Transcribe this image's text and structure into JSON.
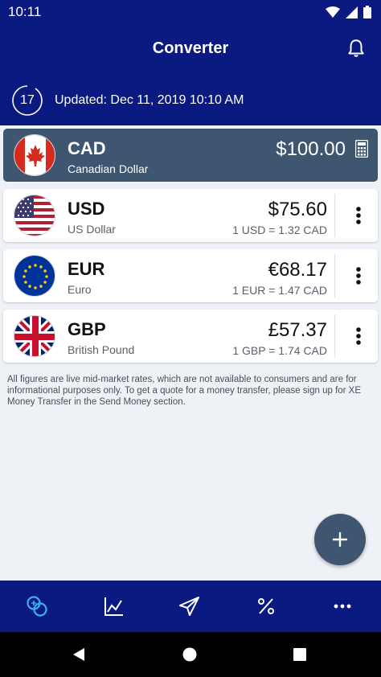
{
  "status_bar": {
    "time": "10:11"
  },
  "app_bar": {
    "title": "Converter",
    "timer_value": "17",
    "updated_text": "Updated: Dec 11, 2019 10:10 AM"
  },
  "base_currency": {
    "code": "CAD",
    "name": "Canadian Dollar",
    "amount": "$100.00",
    "flag_icon": "canada-flag-icon"
  },
  "currencies": [
    {
      "code": "USD",
      "name": "US Dollar",
      "amount": "$75.60",
      "rate": "1 USD = 1.32 CAD",
      "flag_icon": "usa-flag-icon"
    },
    {
      "code": "EUR",
      "name": "Euro",
      "amount": "€68.17",
      "rate": "1 EUR = 1.47 CAD",
      "flag_icon": "eu-flag-icon"
    },
    {
      "code": "GBP",
      "name": "British Pound",
      "amount": "£57.37",
      "rate": "1 GBP = 1.74 CAD",
      "flag_icon": "uk-flag-icon"
    }
  ],
  "disclaimer": "All figures are live mid-market rates, which are not available to consumers and are for informational purposes only. To get a quote for a money transfer, please sign up for XE Money Transfer in the Send Money section.",
  "bottom_nav": [
    {
      "icon": "converter-icon",
      "active": true
    },
    {
      "icon": "chart-icon",
      "active": false
    },
    {
      "icon": "send-money-icon",
      "active": false
    },
    {
      "icon": "rates-percent-icon",
      "active": false
    },
    {
      "icon": "more-icon",
      "active": false
    }
  ],
  "colors": {
    "primary": "#0b1a80",
    "card_dark": "#3f5670",
    "active_nav": "#37b0f0",
    "background": "#eef1f6"
  }
}
